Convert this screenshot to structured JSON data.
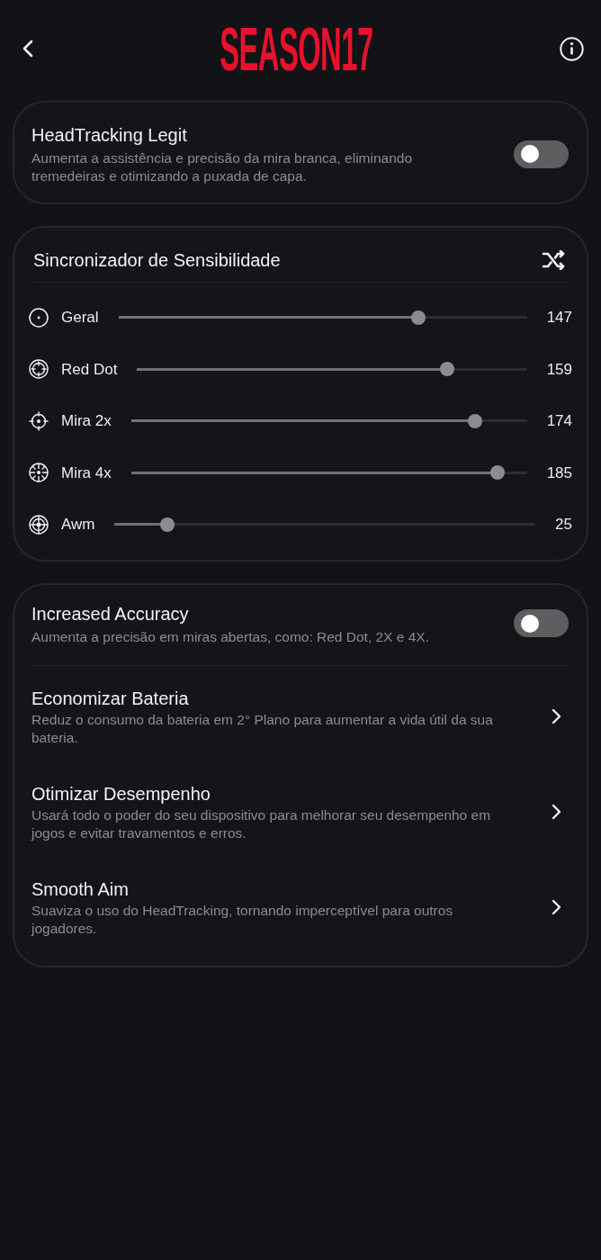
{
  "header": {
    "logo": "SEASON17"
  },
  "headtracking": {
    "title": "HeadTracking Legit",
    "description": "Aumenta a assistência e precisão da mira branca, eliminando tremedeiras e otimizando a puxada de capa.",
    "on": false
  },
  "sensitivity": {
    "title": "Sincronizador de Sensibilidade",
    "sliders": [
      {
        "label": "Geral",
        "level": 0.735,
        "value": "147"
      },
      {
        "label": "Red Dot",
        "level": 0.795,
        "value": "159"
      },
      {
        "label": "Mira 2x",
        "level": 0.87,
        "value": "174"
      },
      {
        "label": "Mira 4x",
        "level": 0.925,
        "value": "185"
      },
      {
        "label": "Awm",
        "level": 0.125,
        "value": "25"
      }
    ]
  },
  "options": [
    {
      "kind": "toggle",
      "title": "Increased Accuracy",
      "description": "Aumenta a precisão em miras abertas, como: Red Dot, 2X e 4X.",
      "on": false
    },
    {
      "kind": "link",
      "title": "Economizar Bateria",
      "description": "Reduz o consumo da bateria em 2° Plano para aumentar a vida útil da sua bateria."
    },
    {
      "kind": "link",
      "title": "Otimizar Desempenho",
      "description": "Usará todo o poder do seu dispositivo para melhorar seu desempenho em jogos e evitar travamentos e erros."
    },
    {
      "kind": "link",
      "title": "Smooth Aim",
      "description": "Suaviza o uso do HeadTracking, tornando imperceptível para outros jogadores."
    }
  ]
}
